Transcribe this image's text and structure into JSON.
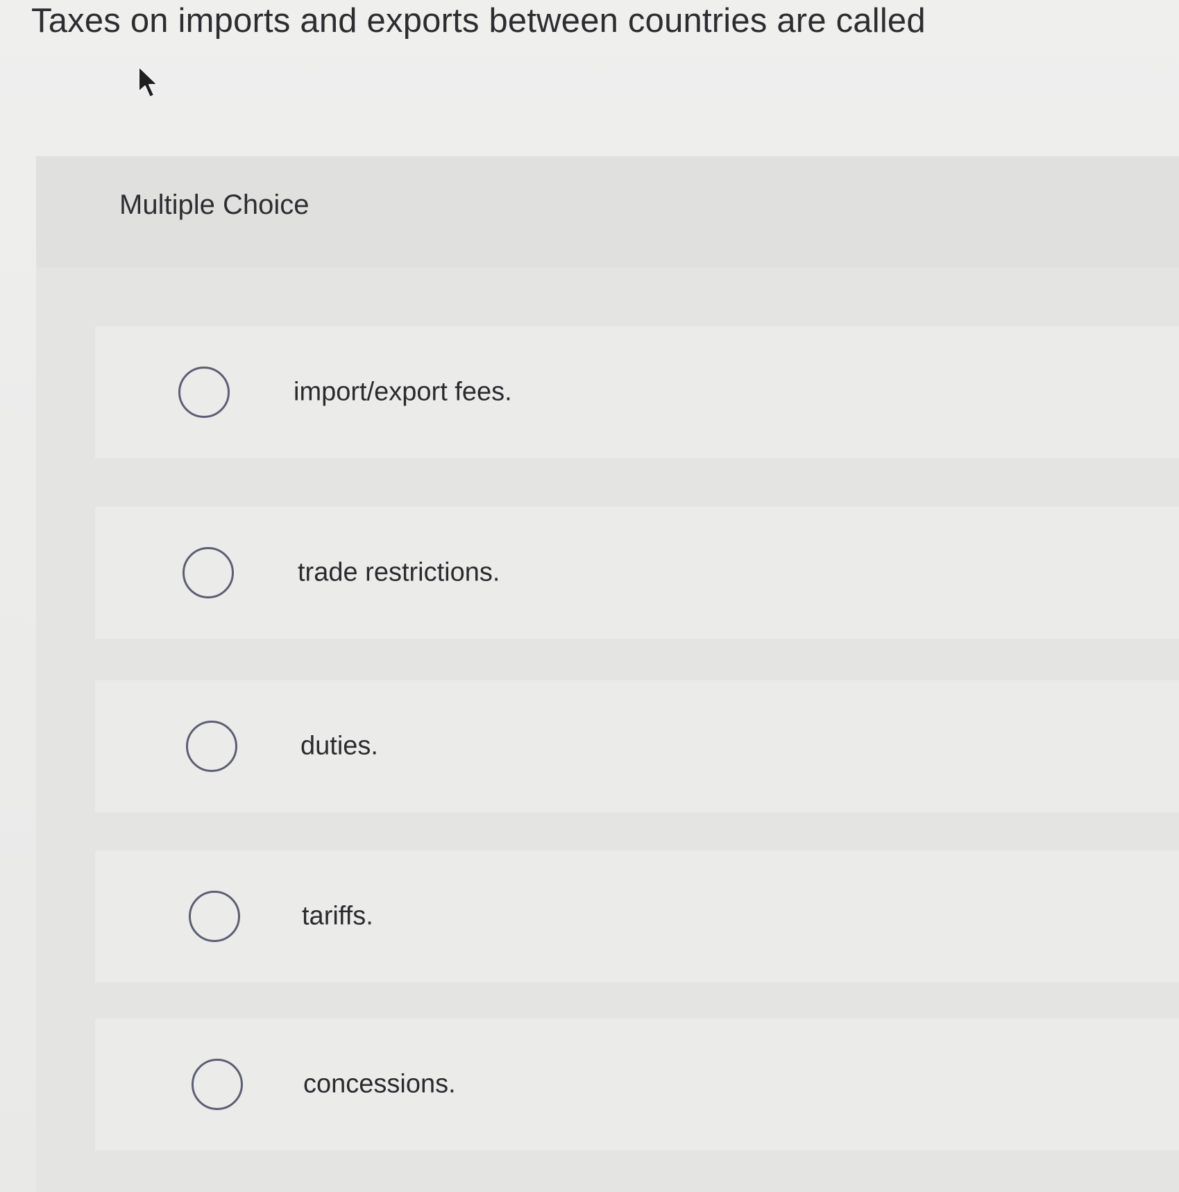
{
  "question": {
    "text": "Taxes on imports and exports between countries are called"
  },
  "section": {
    "label": "Multiple Choice"
  },
  "choices": [
    {
      "label": "import/export fees.",
      "selected": false
    },
    {
      "label": "trade restrictions.",
      "selected": false
    },
    {
      "label": "duties.",
      "selected": false
    },
    {
      "label": "tariffs.",
      "selected": false
    },
    {
      "label": "concessions.",
      "selected": false
    }
  ],
  "icons": {
    "cursor": "mouse-pointer-icon",
    "radio": "radio-button-unchecked-icon"
  },
  "colors": {
    "background": "#ececeb",
    "panel": "#e4e4e3",
    "radio_border": "#5b5f72",
    "text": "#2b2b2f"
  }
}
